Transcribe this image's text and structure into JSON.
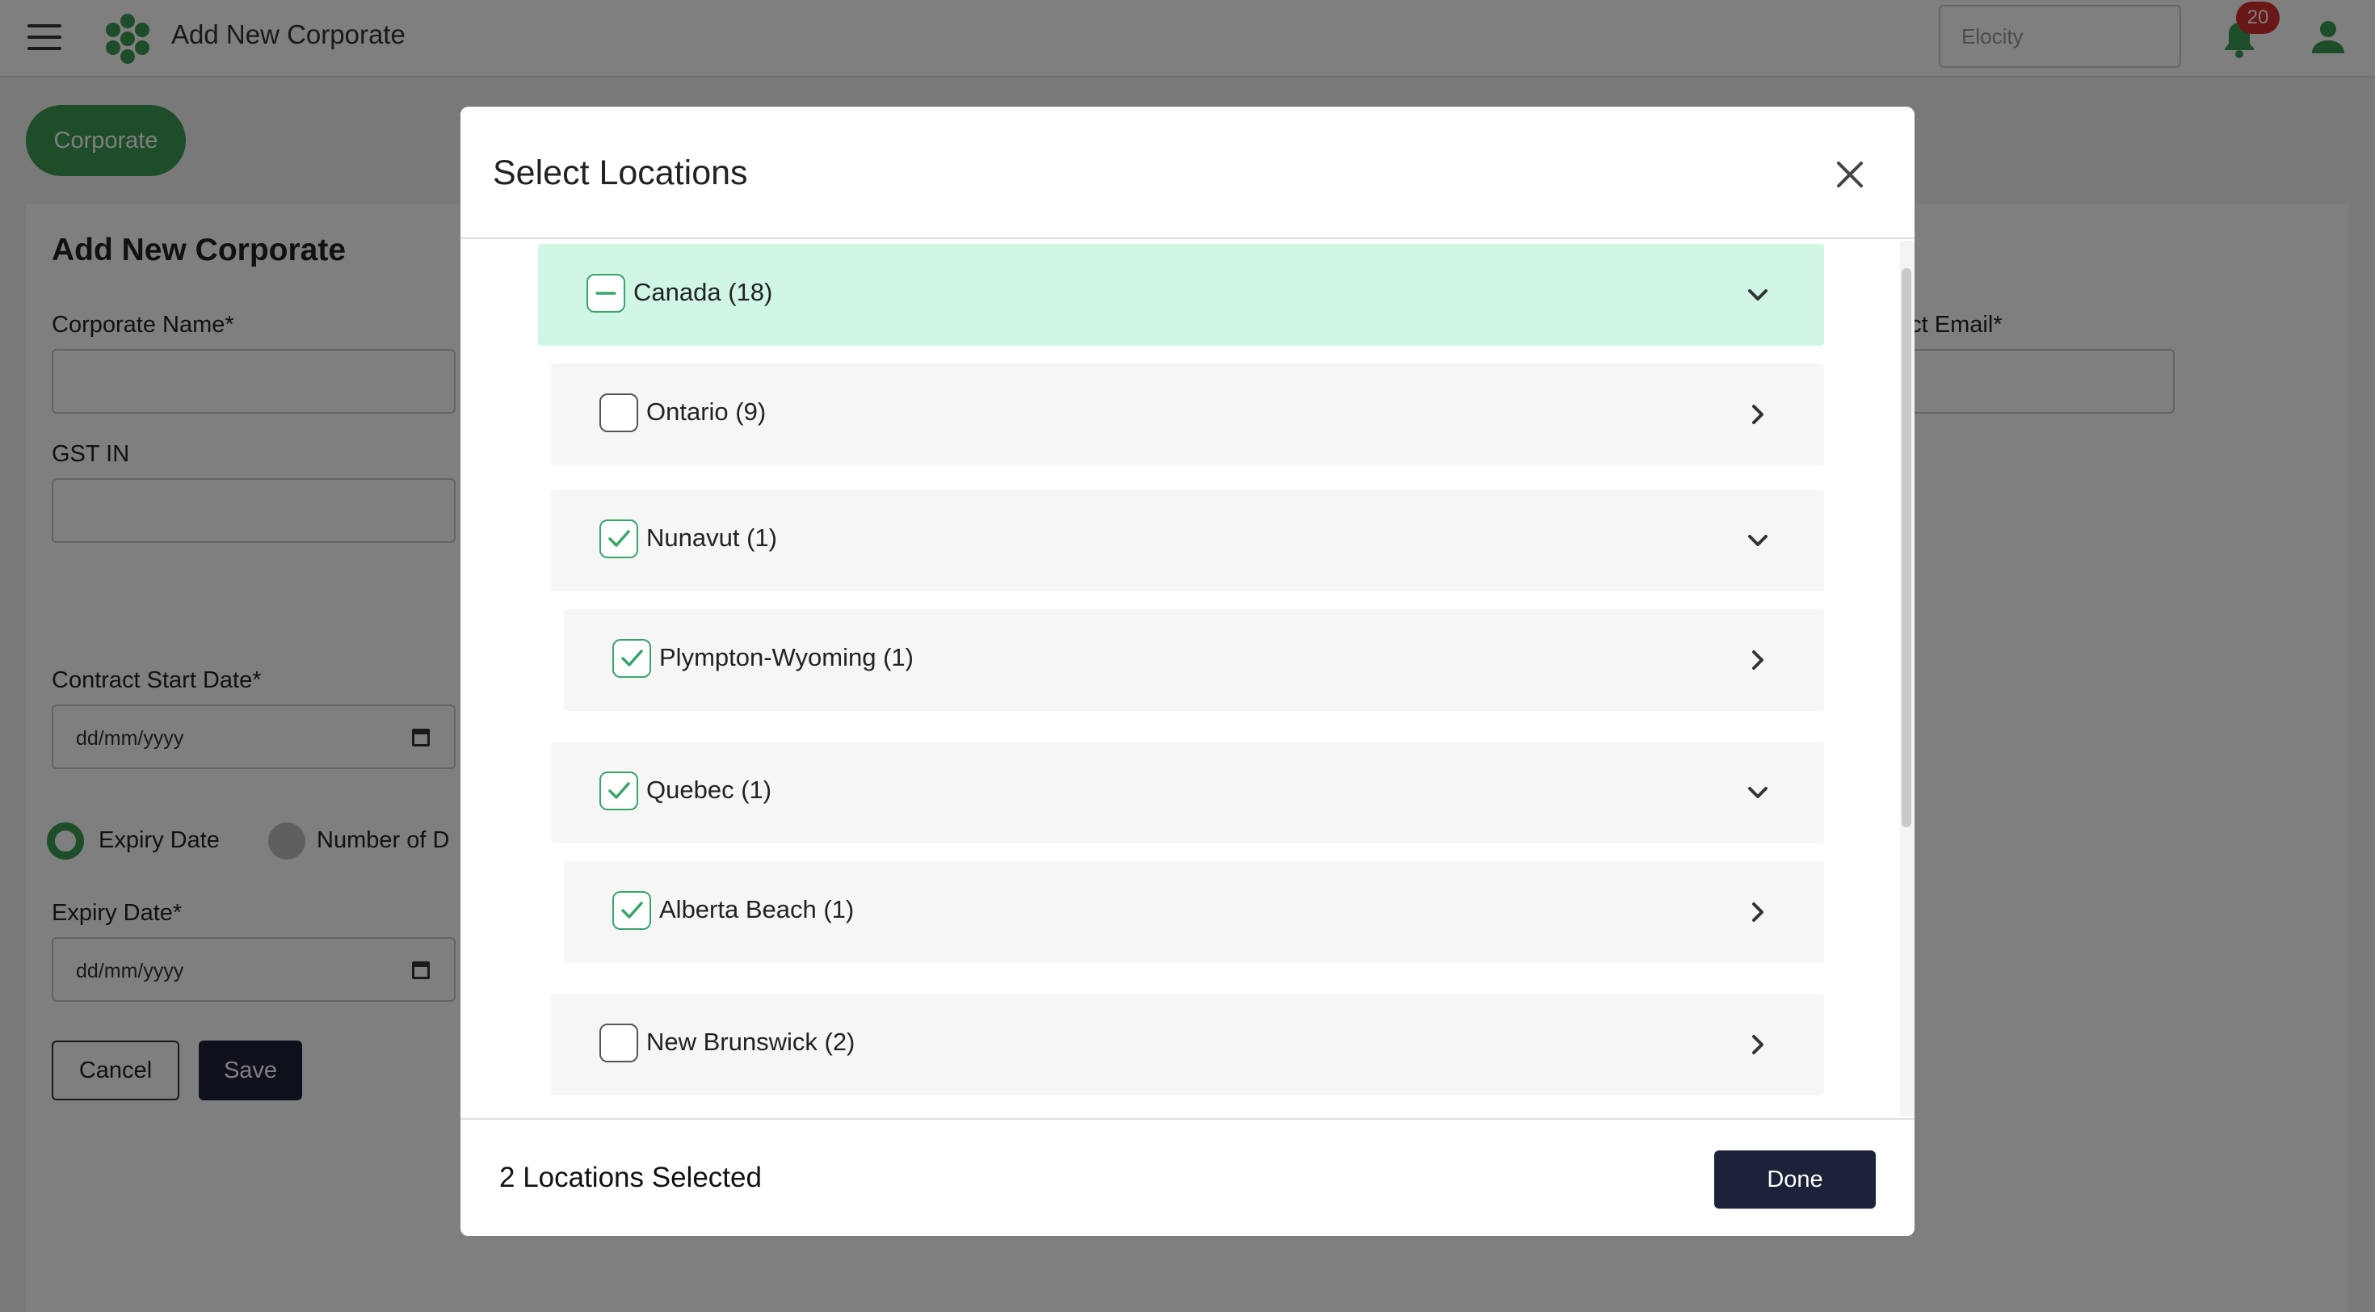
{
  "header": {
    "title": "Add New Corporate",
    "brand_value": "Elocity",
    "notification_count": "20",
    "menu_icon": "hamburger-menu-icon",
    "logo_icon": "hexagon-cluster-logo",
    "bell_icon": "bell-icon",
    "user_icon": "user-icon"
  },
  "colors": {
    "accent_green": "#3a9a52",
    "dark_navy": "#1c2238",
    "root_highlight": "#d0f7e6",
    "badge_red": "#d32f2f"
  },
  "page": {
    "breadcrumb_pill": "Corporate",
    "card_title": "Add New Corporate",
    "fields": {
      "corporate_name_label": "Corporate Name*",
      "gst_label": "GST IN",
      "contact_email_label_visible": "tact Email*",
      "contract_start_label": "Contract Start Date*",
      "contract_start_value": "dd/mm/yyyy",
      "expiry_label": "Expiry Date*",
      "expiry_value": "dd/mm/yyyy"
    },
    "radio": {
      "expiry_option": "Expiry Date",
      "number_option_visible": "Number of D",
      "selected": "Expiry Date"
    },
    "buttons": {
      "cancel": "Cancel",
      "save": "Save"
    }
  },
  "modal": {
    "title": "Select Locations",
    "close_icon": "close-icon",
    "tree": [
      {
        "label": "Canada (18)",
        "state": "partial",
        "expanded": true,
        "level": 0
      },
      {
        "label": "Ontario (9)",
        "state": "unchecked",
        "expanded": false,
        "level": 1
      },
      {
        "label": "Nunavut (1)",
        "state": "checked",
        "expanded": true,
        "level": 1
      },
      {
        "label": "Plympton-Wyoming (1)",
        "state": "checked",
        "expanded": false,
        "level": 2
      },
      {
        "label": "Quebec (1)",
        "state": "checked",
        "expanded": true,
        "level": 1
      },
      {
        "label": "Alberta Beach (1)",
        "state": "checked",
        "expanded": false,
        "level": 2
      },
      {
        "label": "New Brunswick (2)",
        "state": "unchecked",
        "expanded": false,
        "level": 1
      }
    ],
    "footer": {
      "selected_text": "2 Locations Selected",
      "done_label": "Done"
    }
  }
}
